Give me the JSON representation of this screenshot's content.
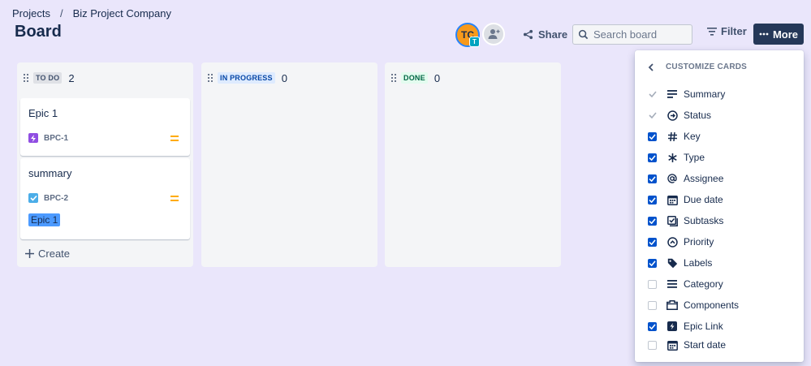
{
  "breadcrumb": {
    "items": [
      "Projects",
      "Biz Project Company"
    ],
    "separator": "/"
  },
  "page": {
    "title": "Board"
  },
  "header": {
    "avatar_initials": "TC",
    "avatar_badge": "T",
    "share_label": "Share",
    "search_placeholder": "Search board",
    "filter_label": "Filter",
    "more_label": "More",
    "more_icon": "ellipsis-icon"
  },
  "columns": [
    {
      "name": "TO DO",
      "count": "2",
      "badge_bg": "#dfe1e6",
      "badge_fg": "#42526e"
    },
    {
      "name": "IN PROGRESS",
      "count": "0",
      "badge_bg": "#deebff",
      "badge_fg": "#0747a6"
    },
    {
      "name": "DONE",
      "count": "0",
      "badge_bg": "#e3fcef",
      "badge_fg": "#006644"
    }
  ],
  "cards": [
    {
      "title": "Epic 1",
      "key": "BPC-1",
      "type_icon": "epic-icon",
      "type_color": "#904ee2",
      "priority_icon": "priority-medium-icon"
    },
    {
      "title": "summary",
      "key": "BPC-2",
      "type_icon": "task-icon",
      "type_color": "#4bade8",
      "priority_icon": "priority-medium-icon",
      "epic": "Epic 1"
    }
  ],
  "create_label": "Create",
  "customize": {
    "title": "CUSTOMIZE CARDS",
    "options": [
      {
        "label": "Summary",
        "state": "disabled-checked",
        "icon": "summary-icon"
      },
      {
        "label": "Status",
        "state": "disabled-checked",
        "icon": "status-icon"
      },
      {
        "label": "Key",
        "state": "checked",
        "icon": "hash-icon"
      },
      {
        "label": "Type",
        "state": "checked",
        "icon": "asterisk-icon"
      },
      {
        "label": "Assignee",
        "state": "checked",
        "icon": "at-icon"
      },
      {
        "label": "Due date",
        "state": "checked",
        "icon": "calendar-icon"
      },
      {
        "label": "Subtasks",
        "state": "checked",
        "icon": "subtasks-icon"
      },
      {
        "label": "Priority",
        "state": "checked",
        "icon": "priority-icon"
      },
      {
        "label": "Labels",
        "state": "checked",
        "icon": "tag-icon"
      },
      {
        "label": "Category",
        "state": "unchecked",
        "icon": "category-icon"
      },
      {
        "label": "Components",
        "state": "unchecked",
        "icon": "components-icon"
      },
      {
        "label": "Epic Link",
        "state": "checked",
        "icon": "epic-link-icon"
      },
      {
        "label": "Start date",
        "state": "unchecked",
        "icon": "calendar-icon"
      }
    ]
  },
  "colors": {
    "background": "#eae6fb",
    "primary": "#0052cc",
    "more_button": "#253858"
  }
}
